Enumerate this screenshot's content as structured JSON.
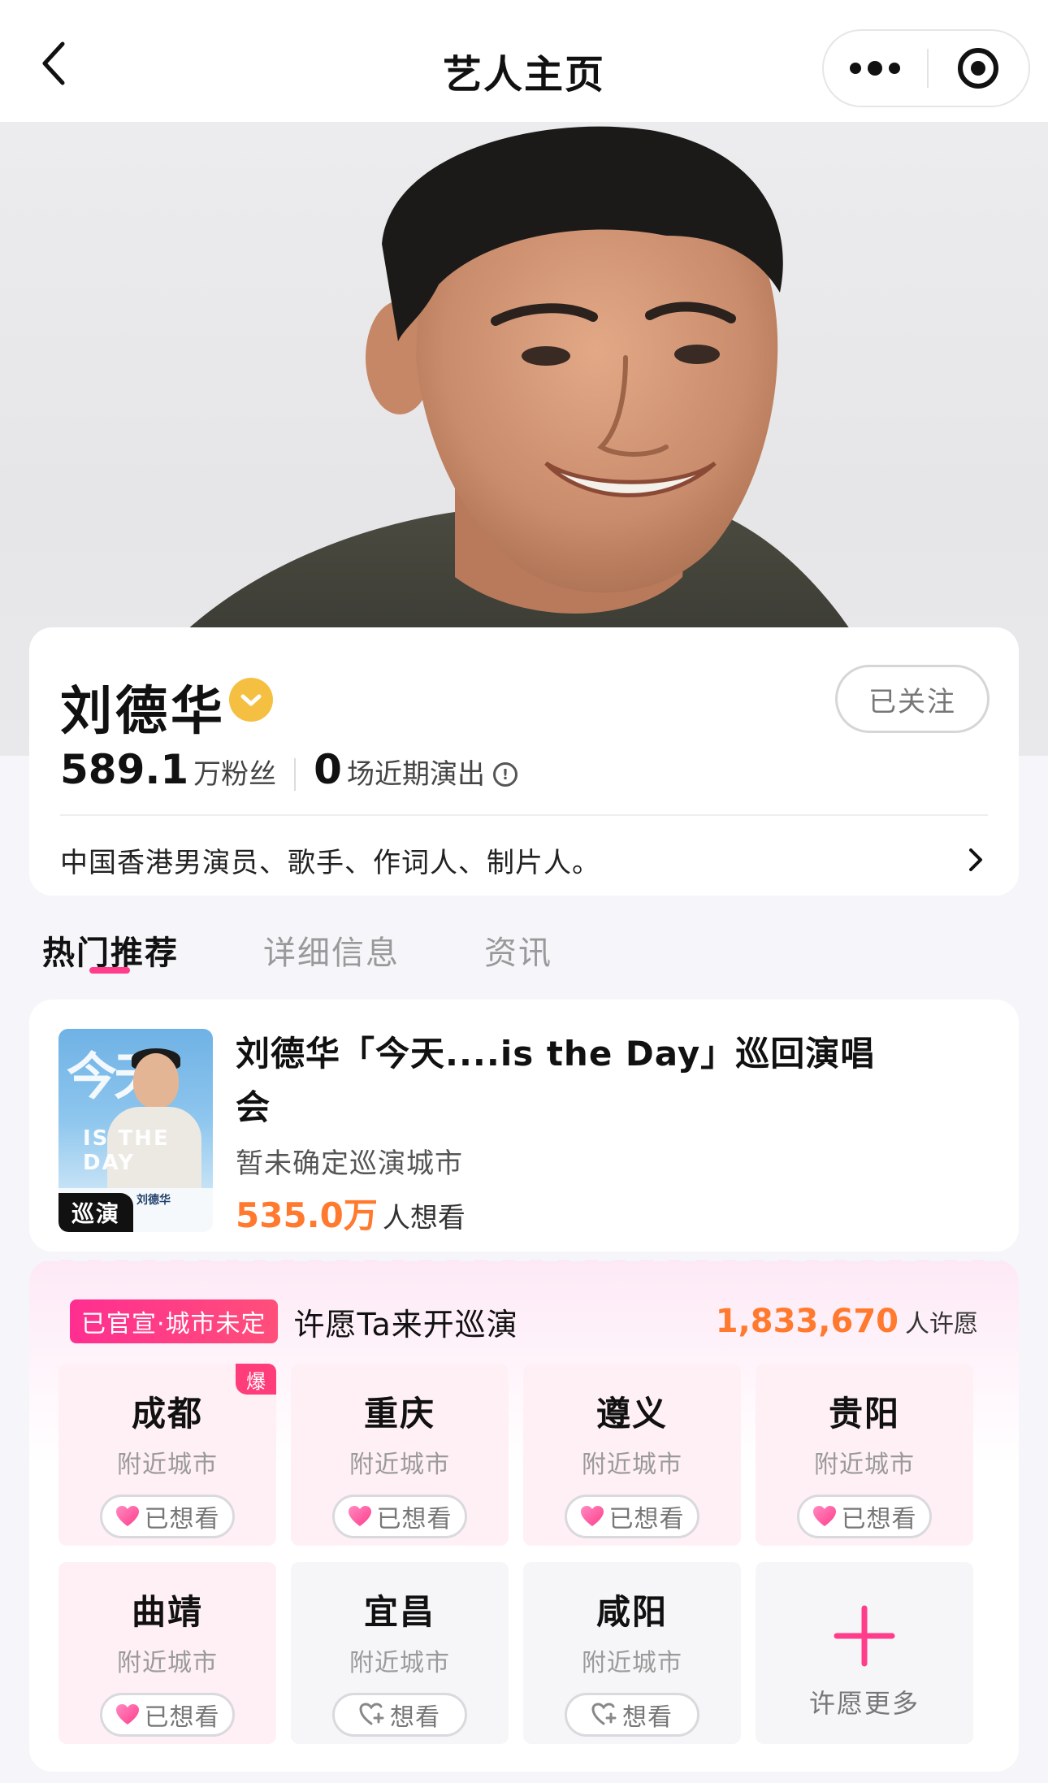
{
  "nav": {
    "title": "艺人主页",
    "icons": [
      "chevron-left-icon",
      "more-dots-icon",
      "target-circle-icon"
    ]
  },
  "artist": {
    "name": "刘德华",
    "verified": true,
    "follow_label": "已关注",
    "fans_value": "589.1",
    "fans_unit": "万粉丝",
    "shows_value": "0",
    "shows_unit": "场近期演出",
    "bio": "中国香港男演员、歌手、作词人、制片人。"
  },
  "tabs": [
    {
      "label": "热门推荐",
      "active": true
    },
    {
      "label": "详细信息",
      "active": false
    },
    {
      "label": "资讯",
      "active": false
    }
  ],
  "event": {
    "title": "刘德华「今天....is the Day」巡回演唱会",
    "city": "暂未确定巡演城市",
    "want_value": "535.0万",
    "want_unit": "人想看",
    "badge": "巡演",
    "poster": {
      "title": "今天",
      "subtitle": "IS THE DAY",
      "name": "刘德华"
    }
  },
  "wish": {
    "tag": "已官宣·城市未定",
    "label": "许愿Ta来开巡演",
    "count_value": "1,833,670",
    "count_unit": "人许愿",
    "cities": [
      {
        "name": "成都",
        "sub": "附近城市",
        "button": "已想看",
        "wanted": true,
        "hot": "爆"
      },
      {
        "name": "重庆",
        "sub": "附近城市",
        "button": "已想看",
        "wanted": true
      },
      {
        "name": "遵义",
        "sub": "附近城市",
        "button": "已想看",
        "wanted": true
      },
      {
        "name": "贵阳",
        "sub": "附近城市",
        "button": "已想看",
        "wanted": true
      },
      {
        "name": "曲靖",
        "sub": "附近城市",
        "button": "已想看",
        "wanted": true
      },
      {
        "name": "宜昌",
        "sub": "附近城市",
        "button": "想看",
        "wanted": false
      },
      {
        "name": "咸阳",
        "sub": "附近城市",
        "button": "想看",
        "wanted": false
      }
    ],
    "more_label": "许愿更多"
  },
  "colors": {
    "accent_pink": "#ff3d8a",
    "accent_orange": "#ff7a2f",
    "verified_gold": "#f5c042"
  }
}
